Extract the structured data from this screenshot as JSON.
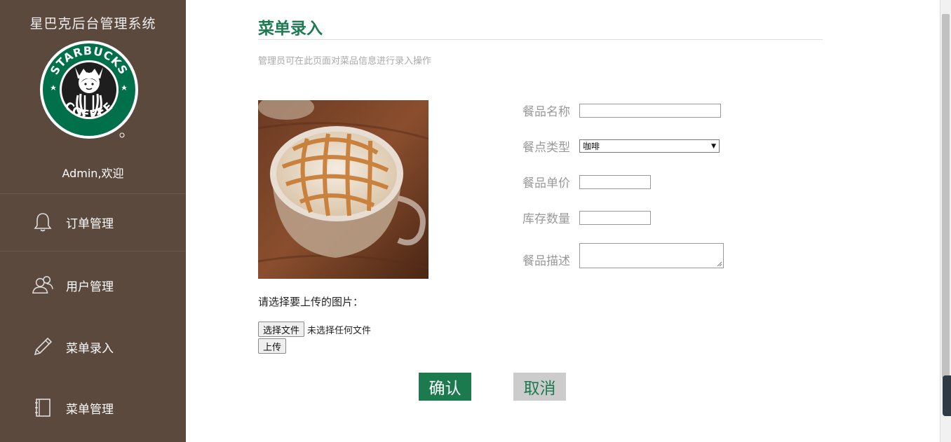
{
  "sidebar": {
    "system_title": "星巴克后台管理系统",
    "logo_alt": "STARBUCKS COFFEE",
    "welcome": "Admin,欢迎",
    "nav": [
      {
        "label": "订单管理",
        "icon": "bell-icon"
      },
      {
        "label": "用户管理",
        "icon": "users-icon"
      },
      {
        "label": "菜单录入",
        "icon": "pencil-icon"
      },
      {
        "label": "菜单管理",
        "icon": "notebook-icon"
      }
    ]
  },
  "main": {
    "title": "菜单录入",
    "description": "管理员可在此页面对菜品信息进行录入操作",
    "upload_prompt": "请选择要上传的图片：",
    "choose_file_label": "选择文件",
    "no_file_text": "未选择任何文件",
    "upload_label": "上传",
    "form": {
      "name_label": "餐品名称",
      "name_value": "",
      "type_label": "餐点类型",
      "type_value": "咖啡",
      "price_label": "餐品单价",
      "price_value": "",
      "stock_label": "库存数量",
      "stock_value": "",
      "desc_label": "餐品描述",
      "desc_value": ""
    },
    "confirm_label": "确认",
    "cancel_label": "取消"
  },
  "colors": {
    "sidebar_bg": "#5c493d",
    "accent_green": "#1c7a4f",
    "cancel_bg": "#cccccc"
  }
}
